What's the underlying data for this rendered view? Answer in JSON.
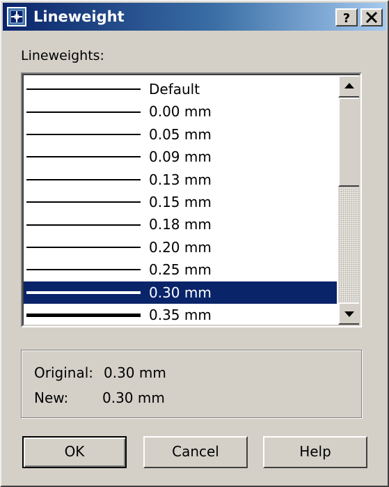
{
  "window": {
    "title": "Lineweight",
    "help_button": "?",
    "close_button": "close"
  },
  "list": {
    "label": "Lineweights:",
    "items": [
      {
        "label": "Default",
        "weight": 2,
        "selected": false
      },
      {
        "label": "0.00 mm",
        "weight": 2,
        "selected": false
      },
      {
        "label": "0.05 mm",
        "weight": 2,
        "selected": false
      },
      {
        "label": "0.09 mm",
        "weight": 2,
        "selected": false
      },
      {
        "label": "0.13 mm",
        "weight": 2,
        "selected": false
      },
      {
        "label": "0.15 mm",
        "weight": 2,
        "selected": false
      },
      {
        "label": "0.18 mm",
        "weight": 2,
        "selected": false
      },
      {
        "label": "0.20 mm",
        "weight": 2,
        "selected": false
      },
      {
        "label": "0.25 mm",
        "weight": 2,
        "selected": false
      },
      {
        "label": "0.30 mm",
        "weight": 4,
        "selected": true
      },
      {
        "label": "0.35 mm",
        "weight": 5,
        "selected": false
      }
    ]
  },
  "info": {
    "original_label": "Original:",
    "original_value": "0.30 mm",
    "new_label": "New:",
    "new_value": "0.30 mm"
  },
  "buttons": {
    "ok": "OK",
    "cancel": "Cancel",
    "help": "Help"
  },
  "colors": {
    "face": "#d4d0c8",
    "selection": "#0a246a",
    "title_gradient_start": "#0a246a",
    "title_gradient_end": "#a6caf0"
  },
  "icons": {
    "title": "lineweight-app-icon",
    "scroll_up": "up-arrow-icon",
    "scroll_down": "down-arrow-icon"
  }
}
